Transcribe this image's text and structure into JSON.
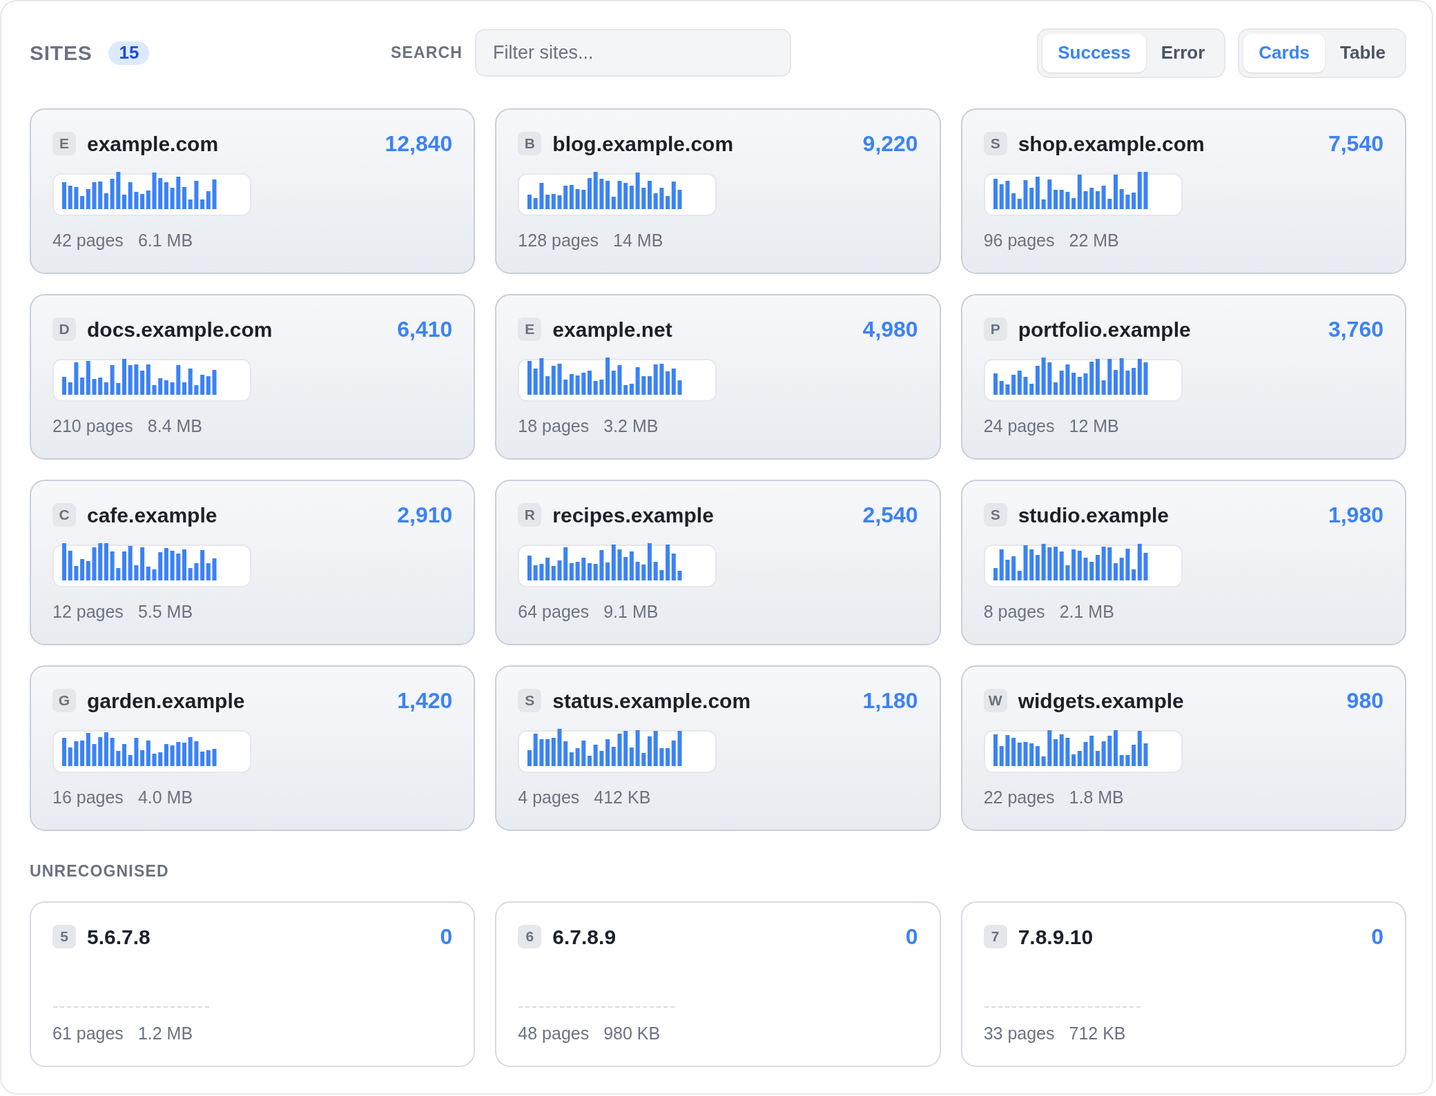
{
  "header": {
    "title": "SITES",
    "count": "15",
    "search": {
      "label": "SEARCH",
      "placeholder": "Filter sites..."
    },
    "status_filter": [
      {
        "label": "Success",
        "selected": true
      },
      {
        "label": "Error",
        "selected": false
      }
    ],
    "view_toggle": [
      {
        "label": "Cards",
        "selected": true
      },
      {
        "label": "Table",
        "selected": false
      }
    ]
  },
  "sites": [
    {
      "initial": "E",
      "name": "example.com",
      "count": "12,840",
      "pages": "42 pages",
      "size": "6.1 MB"
    },
    {
      "initial": "B",
      "name": "blog.example.com",
      "count": "9,220",
      "pages": "128 pages",
      "size": "14 MB"
    },
    {
      "initial": "S",
      "name": "shop.example.com",
      "count": "7,540",
      "pages": "96 pages",
      "size": "22 MB"
    },
    {
      "initial": "D",
      "name": "docs.example.com",
      "count": "6,410",
      "pages": "210 pages",
      "size": "8.4 MB"
    },
    {
      "initial": "E",
      "name": "example.net",
      "count": "4,980",
      "pages": "18 pages",
      "size": "3.2 MB"
    },
    {
      "initial": "P",
      "name": "portfolio.example",
      "count": "3,760",
      "pages": "24 pages",
      "size": "12 MB"
    },
    {
      "initial": "C",
      "name": "cafe.example",
      "count": "2,910",
      "pages": "12 pages",
      "size": "5.5 MB"
    },
    {
      "initial": "R",
      "name": "recipes.example",
      "count": "2,540",
      "pages": "64 pages",
      "size": "9.1 MB"
    },
    {
      "initial": "S",
      "name": "studio.example",
      "count": "1,980",
      "pages": "8 pages",
      "size": "2.1 MB"
    },
    {
      "initial": "G",
      "name": "garden.example",
      "count": "1,420",
      "pages": "16 pages",
      "size": "4.0 MB"
    },
    {
      "initial": "S",
      "name": "status.example.com",
      "count": "1,180",
      "pages": "4 pages",
      "size": "412 KB"
    },
    {
      "initial": "W",
      "name": "widgets.example",
      "count": "980",
      "pages": "22 pages",
      "size": "1.8 MB"
    }
  ],
  "unrecognised": {
    "title": "UNRECOGNISED",
    "sites": [
      {
        "initial": "5",
        "name": "5.6.7.8",
        "count": "0",
        "pages": "61 pages",
        "size": "1.2 MB"
      },
      {
        "initial": "6",
        "name": "6.7.8.9",
        "count": "0",
        "pages": "48 pages",
        "size": "980 KB"
      },
      {
        "initial": "7",
        "name": "7.8.9.10",
        "count": "0",
        "pages": "33 pages",
        "size": "712 KB"
      }
    ]
  }
}
